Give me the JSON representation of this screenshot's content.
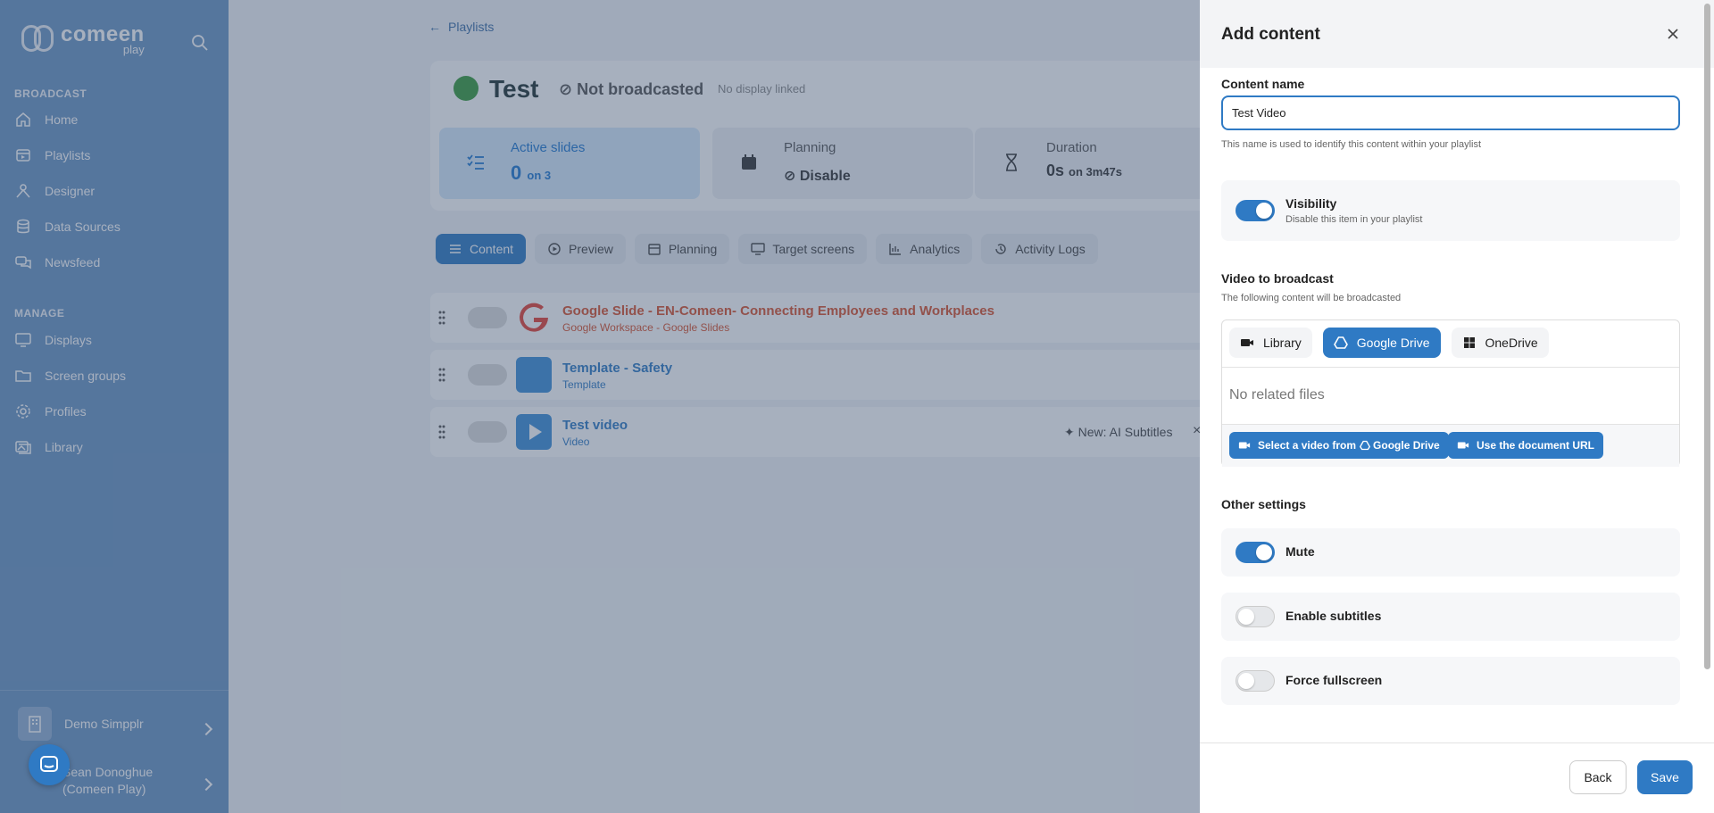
{
  "sidebar": {
    "logo_main": "comeen",
    "logo_sub": "play",
    "broadcast_title": "BROADCAST",
    "broadcast_items": [
      {
        "label": "Home"
      },
      {
        "label": "Playlists"
      },
      {
        "label": "Designer"
      },
      {
        "label": "Data Sources"
      },
      {
        "label": "Newsfeed"
      }
    ],
    "manage_title": "MANAGE",
    "manage_items": [
      {
        "label": "Displays"
      },
      {
        "label": "Screen groups"
      },
      {
        "label": "Profiles"
      },
      {
        "label": "Library"
      }
    ],
    "org_name": "Demo Simpplr",
    "user_name_line1": "Sean Donoghue",
    "user_name_line2": "(Comeen Play)"
  },
  "main": {
    "breadcrumb": "Playlists",
    "title": "Test",
    "status": "Not broadcasted",
    "display_status": "No display linked",
    "stats": [
      {
        "label": "Active slides",
        "value": "0",
        "suffix": "on 3"
      },
      {
        "label": "Planning",
        "value": "Disable",
        "suffix": ""
      },
      {
        "label": "Duration",
        "value": "0s",
        "suffix": "on 3m47s"
      }
    ],
    "tabs": [
      {
        "label": "Content"
      },
      {
        "label": "Preview"
      },
      {
        "label": "Planning"
      },
      {
        "label": "Target screens"
      },
      {
        "label": "Analytics"
      },
      {
        "label": "Activity Logs"
      }
    ],
    "rows": [
      {
        "title": "Google Slide - EN-Comeen- Connecting Employees and Workplaces",
        "subtitle": "Google Workspace - Google Slides",
        "badge": ""
      },
      {
        "title": "Template - Safety",
        "subtitle": "Template",
        "badge": ""
      },
      {
        "title": "Test video",
        "subtitle": "Video",
        "badge": "New: AI Subtitles"
      }
    ]
  },
  "drawer": {
    "title": "Add content",
    "content_name_label": "Content name",
    "content_name_value": "Test Video",
    "content_name_hint": "This name is used to identify this content within your playlist",
    "visibility_label": "Visibility",
    "visibility_sub": "Disable this item in your playlist",
    "video_label": "Video to broadcast",
    "video_hint": "The following content will be broadcasted",
    "source_tabs": [
      {
        "label": "Library"
      },
      {
        "label": "Google Drive"
      },
      {
        "label": "OneDrive"
      }
    ],
    "no_files": "No related files",
    "select_video": "Select a video from",
    "select_video_suffix": "Google Drive",
    "use_url": "Use the document URL",
    "other_settings": "Other settings",
    "mute_label": "Mute",
    "subtitles_label": "Enable subtitles",
    "fullscreen_label": "Force fullscreen",
    "back": "Back",
    "save": "Save"
  },
  "colors": {
    "accent": "#2f7ac4",
    "sidebar": "#6b95c4"
  }
}
